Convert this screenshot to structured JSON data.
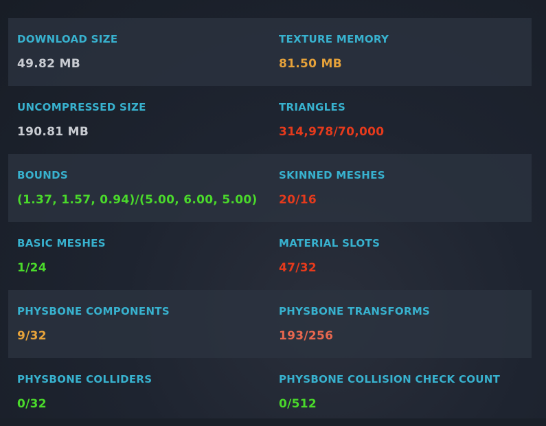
{
  "colors": {
    "label": "#38b2cf",
    "neutral": "#c9ccd2",
    "good": "#4ad92b",
    "warning": "#e6a23a",
    "bad": "#e53a1c",
    "medium_bad": "#e8674f"
  },
  "stats": [
    {
      "left": {
        "label": "DOWNLOAD SIZE",
        "value": "49.82 MB",
        "status": "neutral"
      },
      "right": {
        "label": "TEXTURE MEMORY",
        "value": "81.50 MB",
        "status": "warning"
      }
    },
    {
      "left": {
        "label": "UNCOMPRESSED SIZE",
        "value": "190.81 MB",
        "status": "neutral"
      },
      "right": {
        "label": "TRIANGLES",
        "value": "314,978/70,000",
        "status": "bad"
      }
    },
    {
      "left": {
        "label": "BOUNDS",
        "value": "(1.37, 1.57, 0.94)/(5.00, 6.00, 5.00)",
        "status": "good"
      },
      "right": {
        "label": "SKINNED MESHES",
        "value": "20/16",
        "status": "bad"
      }
    },
    {
      "left": {
        "label": "BASIC MESHES",
        "value": "1/24",
        "status": "good"
      },
      "right": {
        "label": "MATERIAL SLOTS",
        "value": "47/32",
        "status": "bad"
      }
    },
    {
      "left": {
        "label": "PHYSBONE COMPONENTS",
        "value": "9/32",
        "status": "warning"
      },
      "right": {
        "label": "PHYSBONE TRANSFORMS",
        "value": "193/256",
        "status": "medium_bad"
      }
    },
    {
      "left": {
        "label": "PHYSBONE COLLIDERS",
        "value": "0/32",
        "status": "good"
      },
      "right": {
        "label": "PHYSBONE COLLISION CHECK COUNT",
        "value": "0/512",
        "status": "good"
      }
    }
  ]
}
